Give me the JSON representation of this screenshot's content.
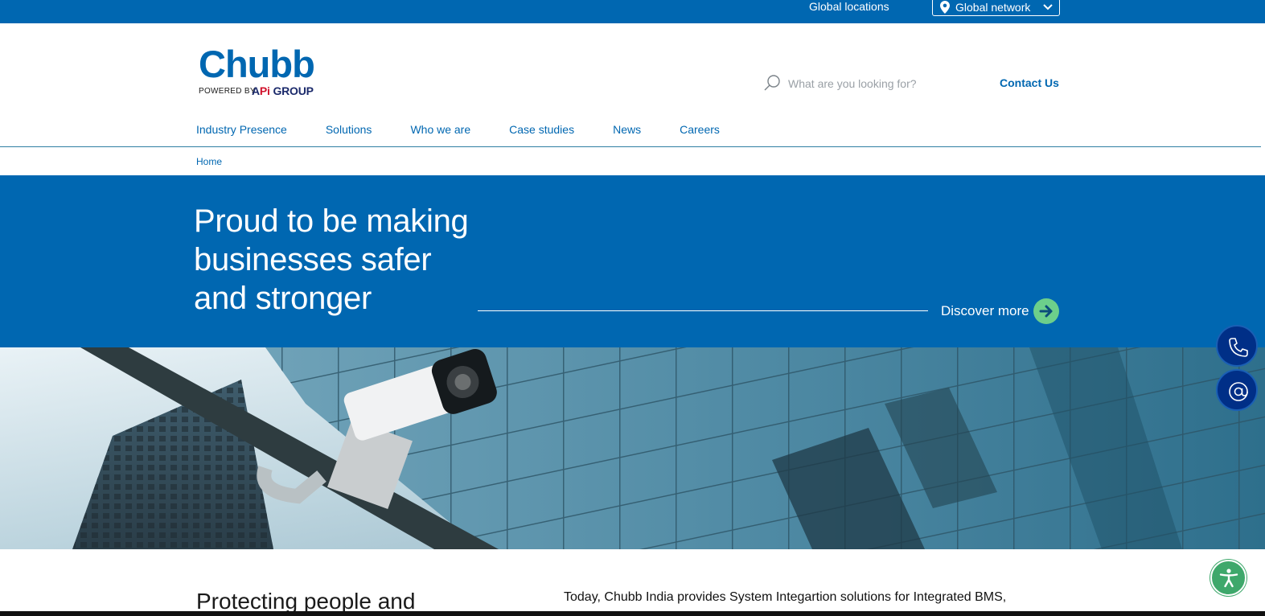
{
  "topbar": {
    "global_locations": "Global locations",
    "global_network": "Global network",
    "pin_icon": "map-pin-icon",
    "chevron_icon": "chevron-down-icon"
  },
  "logo": {
    "wordmark": "Chubb",
    "powered_by": "POWERED BY",
    "api_prefix": "A",
    "api_pi": "Pi",
    "api_group": " GROUP"
  },
  "header": {
    "search_placeholder": "What are you looking for?",
    "search_icon": "search-icon",
    "contact_label": "Contact Us"
  },
  "nav": {
    "items": [
      {
        "label": "Industry Presence"
      },
      {
        "label": "Solutions"
      },
      {
        "label": "Who we are"
      },
      {
        "label": "Case studies"
      },
      {
        "label": "News"
      },
      {
        "label": "Careers"
      }
    ]
  },
  "breadcrumb": {
    "home": "Home"
  },
  "hero": {
    "title_line1": "Proud to be making",
    "title_line2": "businesses safer",
    "title_line3": "and stronger",
    "cta_label": "Discover more",
    "arrow_icon": "arrow-right-circle-icon"
  },
  "floating": {
    "phone_icon": "phone-icon",
    "mail_icon": "at-sign-icon"
  },
  "content": {
    "heading": "Protecting people and",
    "body": "Today, Chubb India provides System Integartion solutions for Integrated BMS,"
  },
  "accessibility": {
    "icon": "accessibility-icon"
  },
  "colors": {
    "brand_blue": "#0067b1",
    "accent_green": "#6ccf8b",
    "fab_navy": "#002f87",
    "a11y_green": "#3ea86b"
  }
}
